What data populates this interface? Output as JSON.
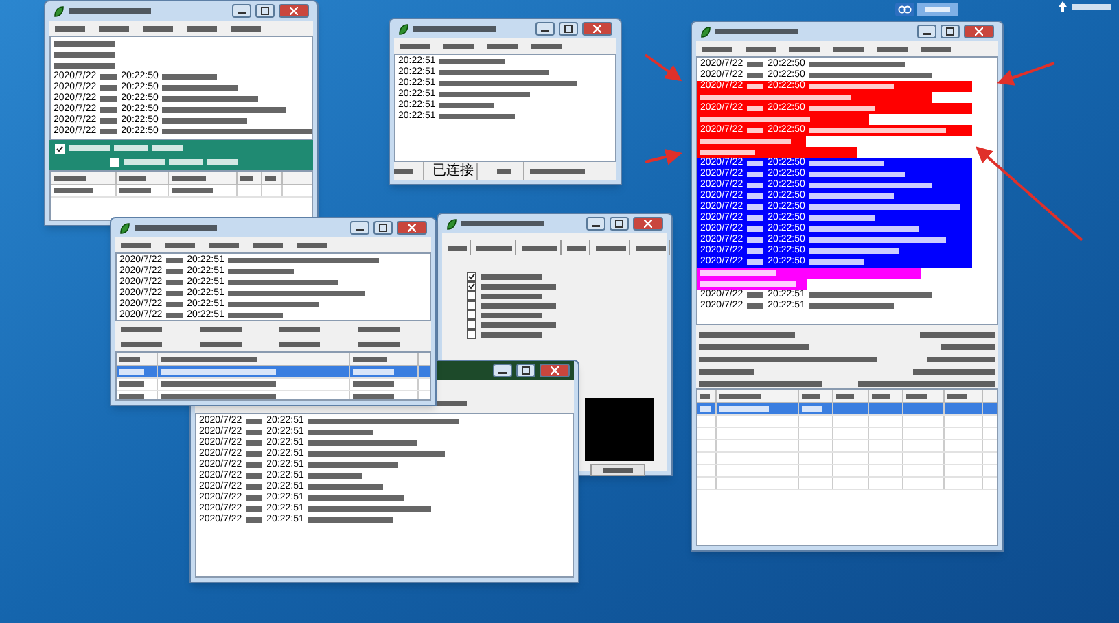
{
  "windows": [
    {
      "kind": "server",
      "checkboxes": [
        {
          "checked": true
        },
        {
          "checked": false
        }
      ],
      "table_rows": [
        {
          "selected": false
        }
      ],
      "lines": [
        {
          "kind": "plain"
        },
        {
          "kind": "plain"
        },
        {
          "kind": "plain"
        },
        {
          "kind": "dated",
          "date": "2020/7/22",
          "time": "20:22:50"
        },
        {
          "kind": "dated",
          "date": "2020/7/22",
          "time": "20:22:50"
        },
        {
          "kind": "dated",
          "date": "2020/7/22",
          "time": "20:22:50"
        },
        {
          "kind": "dated",
          "date": "2020/7/22",
          "time": "20:22:50"
        },
        {
          "kind": "dated",
          "date": "2020/7/22",
          "time": "20:22:50"
        },
        {
          "kind": "dated",
          "date": "2020/7/22",
          "time": "20:22:50"
        }
      ]
    },
    {
      "kind": "log",
      "status": "已连接",
      "lines": [
        {
          "kind": "timed",
          "time": "20:22:51"
        },
        {
          "kind": "timed",
          "time": "20:22:51"
        },
        {
          "kind": "timed",
          "time": "20:22:51"
        },
        {
          "kind": "timed",
          "time": "20:22:51"
        },
        {
          "kind": "timed",
          "time": "20:22:51"
        },
        {
          "kind": "timed",
          "time": "20:22:51"
        }
      ]
    },
    {
      "kind": "client",
      "table_rows": [
        {
          "selected": true
        },
        {
          "selected": false
        },
        {
          "selected": false
        },
        {
          "selected": false
        },
        {
          "selected": false
        },
        {
          "selected": false
        },
        {
          "selected": false
        }
      ],
      "lines": [
        {
          "kind": "dated",
          "date": "2020/7/22",
          "time": "20:22:50"
        },
        {
          "kind": "dated",
          "date": "2020/7/22",
          "time": "20:22:50"
        },
        {
          "kind": "dated",
          "date": "2020/7/22",
          "time": "20:22:50",
          "color": "#ff0000"
        },
        {
          "kind": "plain",
          "color": "#ff0000"
        },
        {
          "kind": "dated",
          "date": "2020/7/22",
          "time": "20:22:50",
          "color": "#ff0000"
        },
        {
          "kind": "plain",
          "color": "#ff0000"
        },
        {
          "kind": "dated",
          "date": "2020/7/22",
          "time": "20:22:50",
          "color": "#ff0000"
        },
        {
          "kind": "plain",
          "color": "#ff0000"
        },
        {
          "kind": "plain",
          "color": "#ff0000"
        },
        {
          "kind": "dated",
          "date": "2020/7/22",
          "time": "20:22:50",
          "color": "#0000ff"
        },
        {
          "kind": "dated",
          "date": "2020/7/22",
          "time": "20:22:50",
          "color": "#0000ff"
        },
        {
          "kind": "dated",
          "date": "2020/7/22",
          "time": "20:22:50",
          "color": "#0000ff"
        },
        {
          "kind": "dated",
          "date": "2020/7/22",
          "time": "20:22:50",
          "color": "#0000ff"
        },
        {
          "kind": "dated",
          "date": "2020/7/22",
          "time": "20:22:50",
          "color": "#0000ff"
        },
        {
          "kind": "dated",
          "date": "2020/7/22",
          "time": "20:22:50",
          "color": "#0000ff"
        },
        {
          "kind": "dated",
          "date": "2020/7/22",
          "time": "20:22:50",
          "color": "#0000ff"
        },
        {
          "kind": "dated",
          "date": "2020/7/22",
          "time": "20:22:50",
          "color": "#0000ff"
        },
        {
          "kind": "dated",
          "date": "2020/7/22",
          "time": "20:22:50",
          "color": "#0000ff"
        },
        {
          "kind": "dated",
          "date": "2020/7/22",
          "time": "20:22:50",
          "color": "#0000ff"
        },
        {
          "kind": "plain",
          "color": "#ff00ff"
        },
        {
          "kind": "plain",
          "color": "#ff00ff"
        },
        {
          "kind": "dated",
          "date": "2020/7/22",
          "time": "20:22:51"
        },
        {
          "kind": "dated",
          "date": "2020/7/22",
          "time": "20:22:51"
        }
      ]
    },
    {
      "kind": "settings",
      "checkboxes": [
        {
          "checked": true
        },
        {
          "checked": true
        },
        {
          "checked": false
        },
        {
          "checked": false
        },
        {
          "checked": false
        },
        {
          "checked": false
        },
        {
          "checked": false
        }
      ]
    },
    {
      "kind": "console",
      "lines": [
        {
          "kind": "dated",
          "date": "2020/7/22",
          "time": "20:22:51"
        },
        {
          "kind": "dated",
          "date": "2020/7/22",
          "time": "20:22:51"
        },
        {
          "kind": "dated",
          "date": "2020/7/22",
          "time": "20:22:51"
        },
        {
          "kind": "dated",
          "date": "2020/7/22",
          "time": "20:22:51"
        },
        {
          "kind": "dated",
          "date": "2020/7/22",
          "time": "20:22:51"
        },
        {
          "kind": "dated",
          "date": "2020/7/22",
          "time": "20:22:51"
        },
        {
          "kind": "dated",
          "date": "2020/7/22",
          "time": "20:22:51"
        },
        {
          "kind": "dated",
          "date": "2020/7/22",
          "time": "20:22:51"
        },
        {
          "kind": "dated",
          "date": "2020/7/22",
          "time": "20:22:51"
        },
        {
          "kind": "dated",
          "date": "2020/7/22",
          "time": "20:22:51"
        }
      ]
    },
    {
      "kind": "events",
      "table_rows": [
        {
          "selected": true
        },
        {
          "selected": false
        },
        {
          "selected": false
        }
      ],
      "lines": [
        {
          "kind": "dated",
          "date": "2020/7/22",
          "time": "20:22:51"
        },
        {
          "kind": "dated",
          "date": "2020/7/22",
          "time": "20:22:51"
        },
        {
          "kind": "dated",
          "date": "2020/7/22",
          "time": "20:22:51"
        },
        {
          "kind": "dated",
          "date": "2020/7/22",
          "time": "20:22:51"
        },
        {
          "kind": "dated",
          "date": "2020/7/22",
          "time": "20:22:51"
        },
        {
          "kind": "dated",
          "date": "2020/7/22",
          "time": "20:22:51"
        }
      ]
    }
  ]
}
